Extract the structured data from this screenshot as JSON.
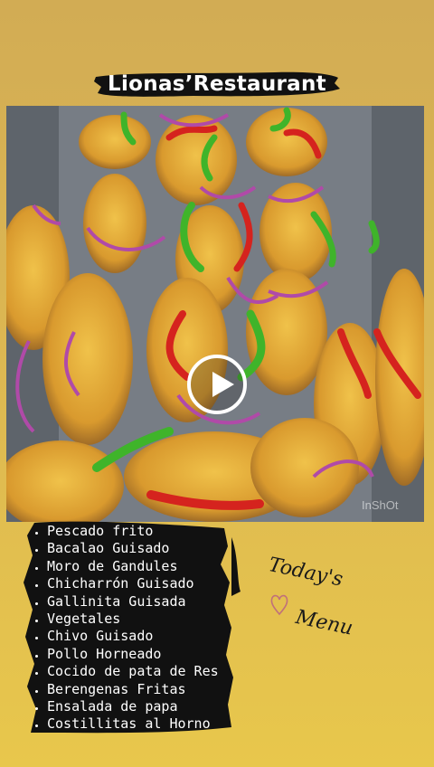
{
  "title": "Lionas’Restaurant",
  "video": {
    "watermark": "InShOt",
    "play_icon": "play-icon"
  },
  "menu": {
    "items": [
      "Pescado frito",
      "Bacalao Guisado",
      "Moro de Gandules",
      "Chicharrón Guisado",
      "Gallinita Guisada",
      "Vegetales",
      "Chivo Guisado",
      "Pollo Horneado",
      "Cocido de pata de Res",
      "Berengenas Fritas",
      "Ensalada de papa",
      "Costillitas al Horno"
    ]
  },
  "today": {
    "line1": "Today's",
    "line2": "Menu"
  },
  "colors": {
    "background": "#dcb752",
    "brush": "#111111",
    "pepper_red": "#d5231e",
    "pepper_green": "#3fb42a",
    "onion": "#b04aa8"
  }
}
